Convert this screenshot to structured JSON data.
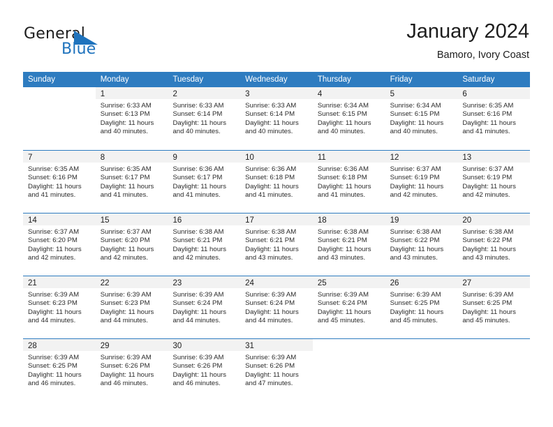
{
  "brand": {
    "name_part1": "General",
    "name_part2": "Blue",
    "flag_color": "#1f73bd",
    "accent_color": "#2e7cc0"
  },
  "header": {
    "title": "January 2024",
    "subtitle": "Bamoro, Ivory Coast"
  },
  "calendar": {
    "weekday_headers": [
      "Sunday",
      "Monday",
      "Tuesday",
      "Wednesday",
      "Thursday",
      "Friday",
      "Saturday"
    ],
    "weeks": [
      [
        {
          "day": "",
          "sunrise": "",
          "sunset": "",
          "daylight_1": "",
          "daylight_2": ""
        },
        {
          "day": "1",
          "sunrise": "Sunrise: 6:33 AM",
          "sunset": "Sunset: 6:13 PM",
          "daylight_1": "Daylight: 11 hours",
          "daylight_2": "and 40 minutes."
        },
        {
          "day": "2",
          "sunrise": "Sunrise: 6:33 AM",
          "sunset": "Sunset: 6:14 PM",
          "daylight_1": "Daylight: 11 hours",
          "daylight_2": "and 40 minutes."
        },
        {
          "day": "3",
          "sunrise": "Sunrise: 6:33 AM",
          "sunset": "Sunset: 6:14 PM",
          "daylight_1": "Daylight: 11 hours",
          "daylight_2": "and 40 minutes."
        },
        {
          "day": "4",
          "sunrise": "Sunrise: 6:34 AM",
          "sunset": "Sunset: 6:15 PM",
          "daylight_1": "Daylight: 11 hours",
          "daylight_2": "and 40 minutes."
        },
        {
          "day": "5",
          "sunrise": "Sunrise: 6:34 AM",
          "sunset": "Sunset: 6:15 PM",
          "daylight_1": "Daylight: 11 hours",
          "daylight_2": "and 40 minutes."
        },
        {
          "day": "6",
          "sunrise": "Sunrise: 6:35 AM",
          "sunset": "Sunset: 6:16 PM",
          "daylight_1": "Daylight: 11 hours",
          "daylight_2": "and 41 minutes."
        }
      ],
      [
        {
          "day": "7",
          "sunrise": "Sunrise: 6:35 AM",
          "sunset": "Sunset: 6:16 PM",
          "daylight_1": "Daylight: 11 hours",
          "daylight_2": "and 41 minutes."
        },
        {
          "day": "8",
          "sunrise": "Sunrise: 6:35 AM",
          "sunset": "Sunset: 6:17 PM",
          "daylight_1": "Daylight: 11 hours",
          "daylight_2": "and 41 minutes."
        },
        {
          "day": "9",
          "sunrise": "Sunrise: 6:36 AM",
          "sunset": "Sunset: 6:17 PM",
          "daylight_1": "Daylight: 11 hours",
          "daylight_2": "and 41 minutes."
        },
        {
          "day": "10",
          "sunrise": "Sunrise: 6:36 AM",
          "sunset": "Sunset: 6:18 PM",
          "daylight_1": "Daylight: 11 hours",
          "daylight_2": "and 41 minutes."
        },
        {
          "day": "11",
          "sunrise": "Sunrise: 6:36 AM",
          "sunset": "Sunset: 6:18 PM",
          "daylight_1": "Daylight: 11 hours",
          "daylight_2": "and 41 minutes."
        },
        {
          "day": "12",
          "sunrise": "Sunrise: 6:37 AM",
          "sunset": "Sunset: 6:19 PM",
          "daylight_1": "Daylight: 11 hours",
          "daylight_2": "and 42 minutes."
        },
        {
          "day": "13",
          "sunrise": "Sunrise: 6:37 AM",
          "sunset": "Sunset: 6:19 PM",
          "daylight_1": "Daylight: 11 hours",
          "daylight_2": "and 42 minutes."
        }
      ],
      [
        {
          "day": "14",
          "sunrise": "Sunrise: 6:37 AM",
          "sunset": "Sunset: 6:20 PM",
          "daylight_1": "Daylight: 11 hours",
          "daylight_2": "and 42 minutes."
        },
        {
          "day": "15",
          "sunrise": "Sunrise: 6:37 AM",
          "sunset": "Sunset: 6:20 PM",
          "daylight_1": "Daylight: 11 hours",
          "daylight_2": "and 42 minutes."
        },
        {
          "day": "16",
          "sunrise": "Sunrise: 6:38 AM",
          "sunset": "Sunset: 6:21 PM",
          "daylight_1": "Daylight: 11 hours",
          "daylight_2": "and 42 minutes."
        },
        {
          "day": "17",
          "sunrise": "Sunrise: 6:38 AM",
          "sunset": "Sunset: 6:21 PM",
          "daylight_1": "Daylight: 11 hours",
          "daylight_2": "and 43 minutes."
        },
        {
          "day": "18",
          "sunrise": "Sunrise: 6:38 AM",
          "sunset": "Sunset: 6:21 PM",
          "daylight_1": "Daylight: 11 hours",
          "daylight_2": "and 43 minutes."
        },
        {
          "day": "19",
          "sunrise": "Sunrise: 6:38 AM",
          "sunset": "Sunset: 6:22 PM",
          "daylight_1": "Daylight: 11 hours",
          "daylight_2": "and 43 minutes."
        },
        {
          "day": "20",
          "sunrise": "Sunrise: 6:38 AM",
          "sunset": "Sunset: 6:22 PM",
          "daylight_1": "Daylight: 11 hours",
          "daylight_2": "and 43 minutes."
        }
      ],
      [
        {
          "day": "21",
          "sunrise": "Sunrise: 6:39 AM",
          "sunset": "Sunset: 6:23 PM",
          "daylight_1": "Daylight: 11 hours",
          "daylight_2": "and 44 minutes."
        },
        {
          "day": "22",
          "sunrise": "Sunrise: 6:39 AM",
          "sunset": "Sunset: 6:23 PM",
          "daylight_1": "Daylight: 11 hours",
          "daylight_2": "and 44 minutes."
        },
        {
          "day": "23",
          "sunrise": "Sunrise: 6:39 AM",
          "sunset": "Sunset: 6:24 PM",
          "daylight_1": "Daylight: 11 hours",
          "daylight_2": "and 44 minutes."
        },
        {
          "day": "24",
          "sunrise": "Sunrise: 6:39 AM",
          "sunset": "Sunset: 6:24 PM",
          "daylight_1": "Daylight: 11 hours",
          "daylight_2": "and 44 minutes."
        },
        {
          "day": "25",
          "sunrise": "Sunrise: 6:39 AM",
          "sunset": "Sunset: 6:24 PM",
          "daylight_1": "Daylight: 11 hours",
          "daylight_2": "and 45 minutes."
        },
        {
          "day": "26",
          "sunrise": "Sunrise: 6:39 AM",
          "sunset": "Sunset: 6:25 PM",
          "daylight_1": "Daylight: 11 hours",
          "daylight_2": "and 45 minutes."
        },
        {
          "day": "27",
          "sunrise": "Sunrise: 6:39 AM",
          "sunset": "Sunset: 6:25 PM",
          "daylight_1": "Daylight: 11 hours",
          "daylight_2": "and 45 minutes."
        }
      ],
      [
        {
          "day": "28",
          "sunrise": "Sunrise: 6:39 AM",
          "sunset": "Sunset: 6:25 PM",
          "daylight_1": "Daylight: 11 hours",
          "daylight_2": "and 46 minutes."
        },
        {
          "day": "29",
          "sunrise": "Sunrise: 6:39 AM",
          "sunset": "Sunset: 6:26 PM",
          "daylight_1": "Daylight: 11 hours",
          "daylight_2": "and 46 minutes."
        },
        {
          "day": "30",
          "sunrise": "Sunrise: 6:39 AM",
          "sunset": "Sunset: 6:26 PM",
          "daylight_1": "Daylight: 11 hours",
          "daylight_2": "and 46 minutes."
        },
        {
          "day": "31",
          "sunrise": "Sunrise: 6:39 AM",
          "sunset": "Sunset: 6:26 PM",
          "daylight_1": "Daylight: 11 hours",
          "daylight_2": "and 47 minutes."
        },
        {
          "day": "",
          "sunrise": "",
          "sunset": "",
          "daylight_1": "",
          "daylight_2": ""
        },
        {
          "day": "",
          "sunrise": "",
          "sunset": "",
          "daylight_1": "",
          "daylight_2": ""
        },
        {
          "day": "",
          "sunrise": "",
          "sunset": "",
          "daylight_1": "",
          "daylight_2": ""
        }
      ]
    ]
  }
}
